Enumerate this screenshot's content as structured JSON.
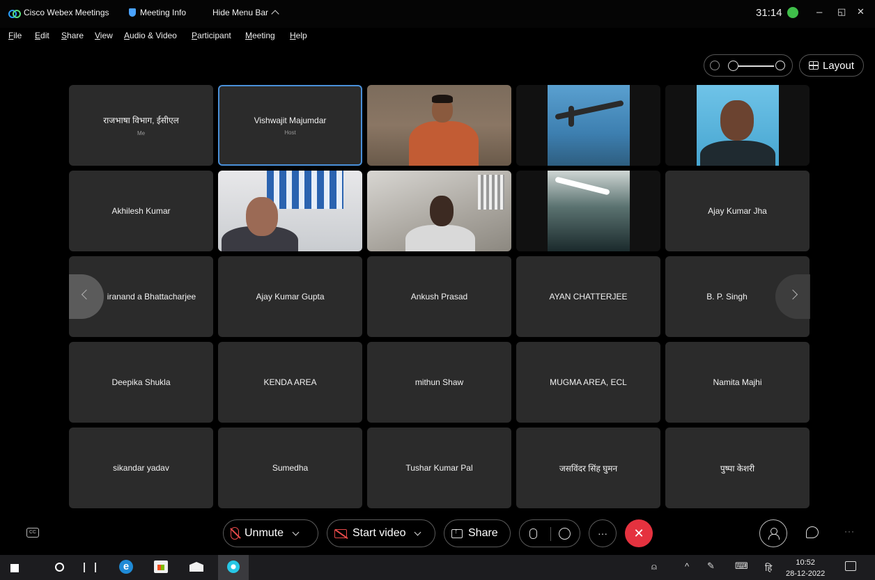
{
  "titlebar": {
    "app_name": "Cisco Webex Meetings",
    "meeting_info": "Meeting Info",
    "hide_menu": "Hide Menu Bar",
    "timer": "31:14",
    "minimize": "–",
    "restore": "◱",
    "close": "✕"
  },
  "menu": [
    "File",
    "Edit",
    "Share",
    "View",
    "Audio & Video",
    "Participant",
    "Meeting",
    "Help"
  ],
  "top_right": {
    "layout_label": "Layout"
  },
  "tiles": [
    {
      "name": "राजभाषा विभाग, ईसीएल",
      "sub": "Me"
    },
    {
      "name": "Vishwajit Majumdar",
      "sub": "Host"
    },
    {
      "name": "Akhilesh Kumar"
    },
    {
      "name": "Ajay Kumar Jha"
    },
    {
      "name": "iranand a Bhattacharjee",
      "display": "iranand a Bhattacharjee"
    },
    {
      "name": "Ajay Kumar Gupta"
    },
    {
      "name": "Ankush Prasad"
    },
    {
      "name": "AYAN CHATTERJEE"
    },
    {
      "name": "B. P. Singh"
    },
    {
      "name": "Deepika Shukla"
    },
    {
      "name": "KENDA AREA"
    },
    {
      "name": "mithun Shaw"
    },
    {
      "name": "MUGMA AREA, ECL"
    },
    {
      "name": "Namita Majhi"
    },
    {
      "name": "sikandar yadav"
    },
    {
      "name": "Sumedha"
    },
    {
      "name": "Tushar Kumar Pal"
    },
    {
      "name": "जसविंदर सिंह घुमन"
    },
    {
      "name": "पुष्पा केशरी"
    }
  ],
  "names": {
    "r1c1": "राजभाषा विभाग, ईसीएल",
    "r1c1_sub": "Me",
    "r1c2": "Vishwajit Majumdar",
    "r1c2_sub": "Host",
    "r2c1": "Akhilesh Kumar",
    "r2c5": "Ajay Kumar Jha",
    "r3c1": "iranand a Bhattacharjee",
    "r3c2": "Ajay Kumar Gupta",
    "r3c3": "Ankush Prasad",
    "r3c4": "AYAN CHATTERJEE",
    "r3c5": "B. P. Singh",
    "r4c1": "Deepika Shukla",
    "r4c2": "KENDA AREA",
    "r4c3": "mithun Shaw",
    "r4c4": "MUGMA AREA, ECL",
    "r4c5": "Namita Majhi",
    "r5c1": "sikandar yadav",
    "r5c2": "Sumedha",
    "r5c3": "Tushar Kumar Pal",
    "r5c4": "जसविंदर सिंह घुमन",
    "r5c5": "पुष्पा केशरी"
  },
  "controls": {
    "unmute": "Unmute",
    "start_video": "Start video",
    "share": "Share",
    "more": "···",
    "end": "✕"
  },
  "taskbar": {
    "time": "10:52",
    "date": "28-12-2022",
    "lang": "हि"
  },
  "colors": {
    "tile_bg": "#2b2b2b",
    "active_border": "#4a90d9",
    "end_call": "#e5323f",
    "muted_icon": "#e84a4a"
  }
}
